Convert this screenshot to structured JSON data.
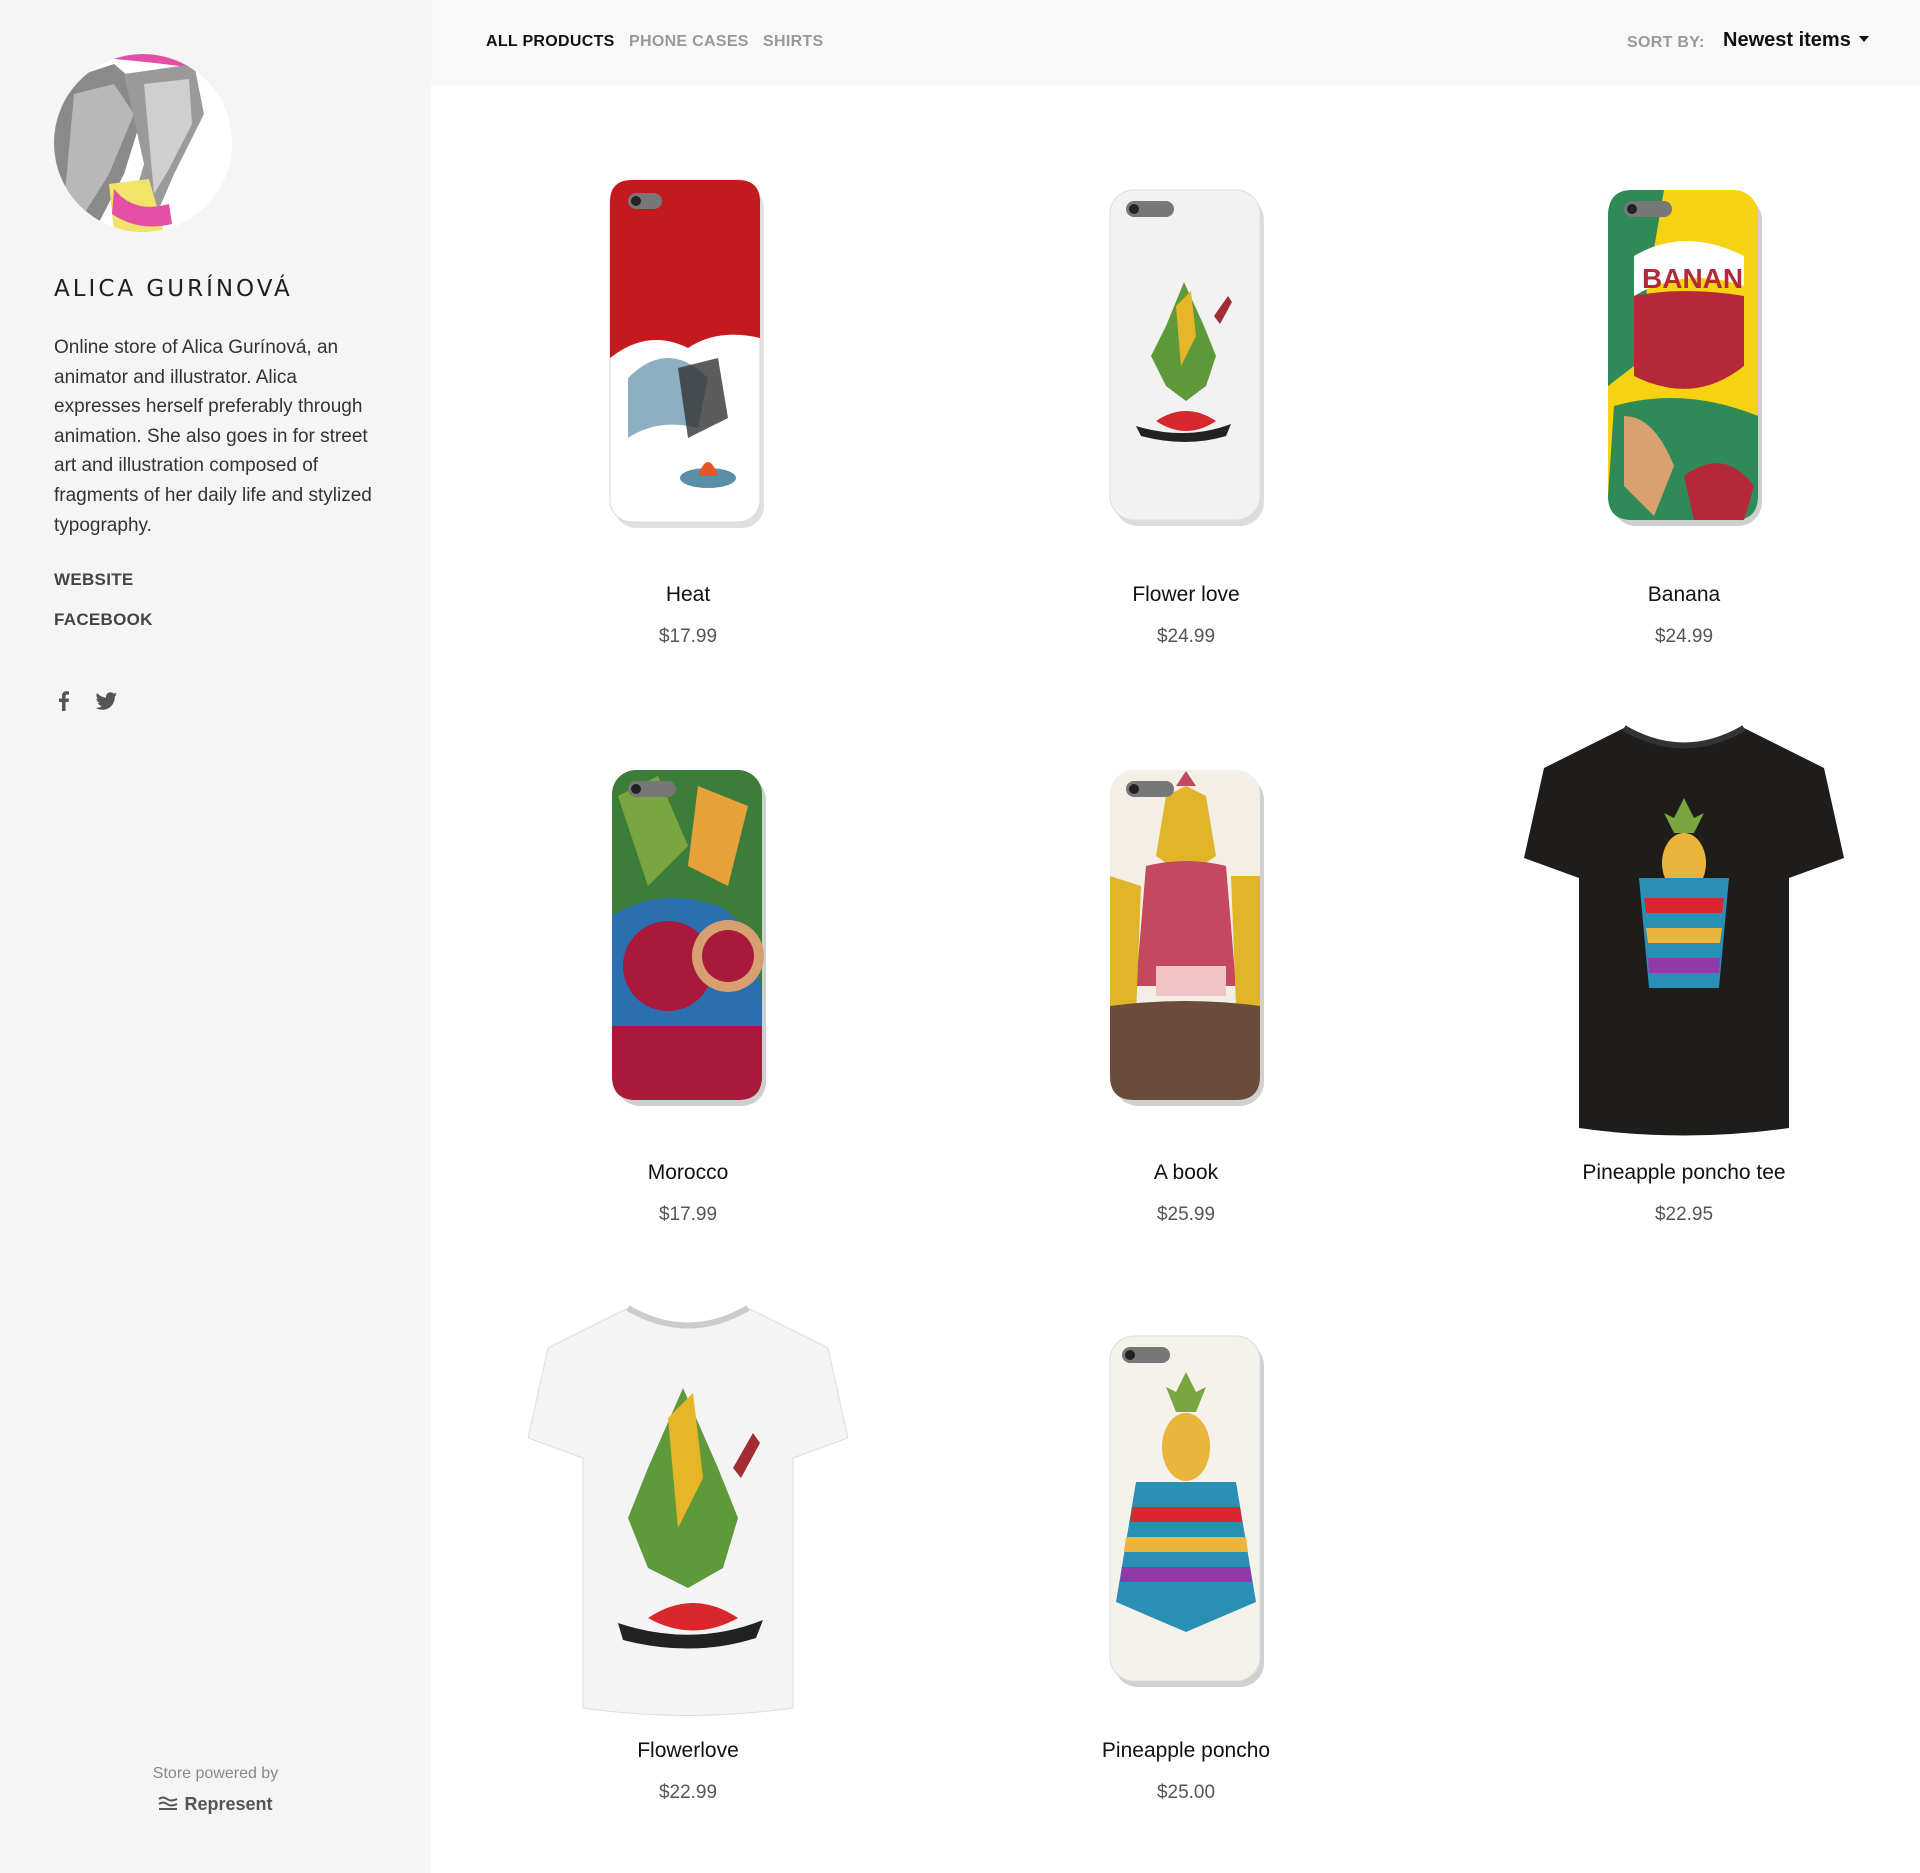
{
  "sidebar": {
    "store_name": "ALICA GURÍNOVÁ",
    "bio": "Online store of Alica Gurínová, an animator and illustrator. Alica expresses herself preferably through animation. She also goes in for street art and illustration composed of fragments of her daily life and stylized typography.",
    "links": {
      "website": "WEBSITE",
      "facebook": "FACEBOOK"
    },
    "social": [
      "facebook-icon",
      "twitter-icon"
    ],
    "powered_by": "Store powered by",
    "brand": "Represent"
  },
  "topbar": {
    "tabs": [
      {
        "label": "ALL PRODUCTS",
        "active": true
      },
      {
        "label": "PHONE CASES",
        "active": false
      },
      {
        "label": "SHIRTS",
        "active": false
      }
    ],
    "sort_label": "SORT BY:",
    "sort_value": "Newest items"
  },
  "products": [
    {
      "name": "Heat",
      "price": "$17.99",
      "kind": "phone-case",
      "colors": [
        "#c4191d",
        "#ffffff",
        "#5b8fa8"
      ]
    },
    {
      "name": "Flower love",
      "price": "$24.99",
      "kind": "phone-case",
      "colors": [
        "#f2f2f2",
        "#5f9a3a",
        "#d9272e"
      ]
    },
    {
      "name": "Banana",
      "price": "$24.99",
      "kind": "phone-case",
      "colors": [
        "#f5d312",
        "#b5283a",
        "#2e8b57"
      ]
    },
    {
      "name": "Morocco",
      "price": "$17.99",
      "kind": "phone-case",
      "colors": [
        "#a8193a",
        "#3d7d3a",
        "#2a6fb0"
      ]
    },
    {
      "name": "A book",
      "price": "$25.99",
      "kind": "phone-case",
      "colors": [
        "#f4efe6",
        "#c4485e",
        "#e0b52a"
      ]
    },
    {
      "name": "Pineapple poncho tee",
      "price": "$22.95",
      "kind": "tee-black",
      "colors": [
        "#1e1d1b",
        "#e9b53a",
        "#2a8fb5"
      ]
    },
    {
      "name": "Flowerlove",
      "price": "$22.99",
      "kind": "tee-white",
      "colors": [
        "#f4f4f4",
        "#5f9a3a",
        "#d9272e"
      ]
    },
    {
      "name": "Pineapple poncho",
      "price": "$25.00",
      "kind": "phone-case",
      "colors": [
        "#f5f2ec",
        "#e9b53a",
        "#2a8fb5"
      ]
    }
  ]
}
